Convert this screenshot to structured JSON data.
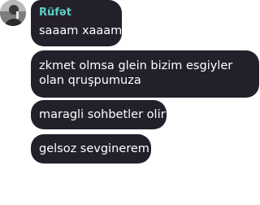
{
  "sender": {
    "name": "Rüfət",
    "name_color": "#5fd0c6",
    "avatar_icon": "user-avatar-photo"
  },
  "messages": [
    {
      "text": "saaam xaaam"
    },
    {
      "text": "zkmet olmsa glein bizim esgiyler olan qruşpumuza"
    },
    {
      "text": "maragli sohbetler olir"
    },
    {
      "text": "gelsoz sevginerem"
    }
  ],
  "colors": {
    "bubble_bg": "#23202b",
    "bubble_text": "#ffffff",
    "page_bg": "#ffffff"
  }
}
